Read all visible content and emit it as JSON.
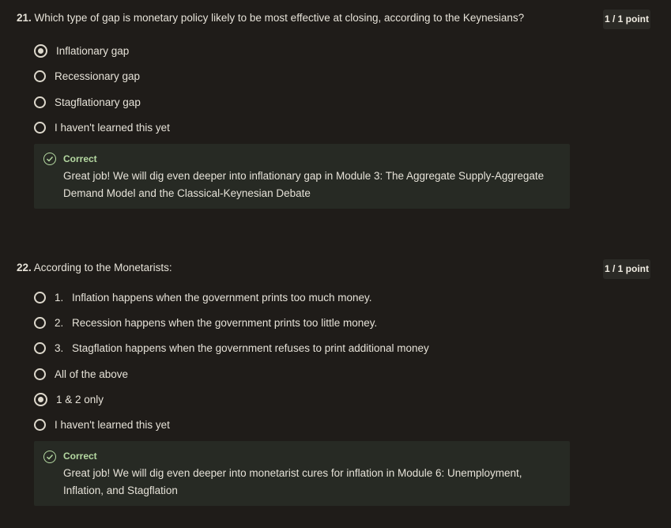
{
  "questions": [
    {
      "number": "21.",
      "text": "Which type of gap is monetary policy likely to be most effective at closing, according to the Keynesians?",
      "points": "1 / 1 point",
      "options": [
        {
          "num": "",
          "label": "Inflationary gap",
          "checked": true
        },
        {
          "num": "",
          "label": "Recessionary gap",
          "checked": false
        },
        {
          "num": "",
          "label": "Stagflationary gap",
          "checked": false
        },
        {
          "num": "",
          "label": "I haven't learned this yet",
          "checked": false
        }
      ],
      "feedback": {
        "icon": "check-circle-icon",
        "title": "Correct",
        "text": "Great job! We will dig even deeper into inflationary gap in Module 3: The Aggregate Supply-Aggregate Demand Model and the Classical-Keynesian Debate"
      }
    },
    {
      "number": "22.",
      "text": "According to the Monetarists:",
      "points": "1 / 1 point",
      "options": [
        {
          "num": "1.",
          "label": "Inflation happens when the government prints too much money.",
          "checked": false
        },
        {
          "num": "2.",
          "label": "Recession happens when the government prints too little money.",
          "checked": false
        },
        {
          "num": "3.",
          "label": "Stagflation happens when the government refuses to print additional money",
          "checked": false
        },
        {
          "num": "",
          "label": "All of the above",
          "checked": false
        },
        {
          "num": "",
          "label": "1 & 2 only",
          "checked": true
        },
        {
          "num": "",
          "label": "I haven't learned this yet",
          "checked": false
        }
      ],
      "feedback": {
        "icon": "check-circle-icon",
        "title": "Correct",
        "text": "Great job! We will dig even deeper into monetarist cures for inflation in Module 6: Unemployment, Inflation, and Stagflation"
      }
    }
  ],
  "colors": {
    "background": "#1f1c19",
    "text": "#e6e2d8",
    "correct": "#b5d9a2",
    "feedback_bg": "#272a24",
    "points_bg": "#2b2a26"
  }
}
